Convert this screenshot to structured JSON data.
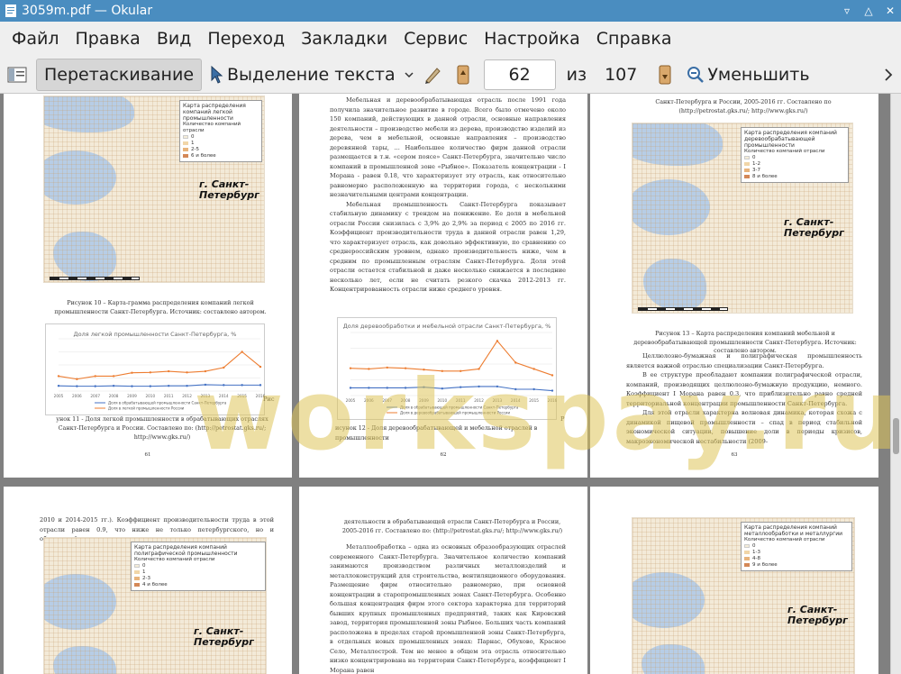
{
  "window": {
    "title": "3059m.pdf — Okular"
  },
  "menu": [
    "Файл",
    "Правка",
    "Вид",
    "Переход",
    "Закладки",
    "Сервис",
    "Настройка",
    "Справка"
  ],
  "toolbar": {
    "drag_label": "Перетаскивание",
    "select_label": "Выделение текста",
    "current_page": "62",
    "of_label": "из",
    "total_pages": "107",
    "zoom_out_label": "Уменьшить"
  },
  "watermark": "workspay.ru",
  "pages": {
    "p61": {
      "map_title": "Карта распределения компаний легкой промышленности",
      "legend_title": "Количество компаний отрасли",
      "legend_items": [
        "0",
        "1",
        "2-5",
        "6 и более"
      ],
      "city": "г. Санкт-Петербург",
      "caption": "Рисунок 10 – Карта-граммa распределения компаний легкой промышленности Санкт-Петербурга. Источник: составлено автором.",
      "chart_title": "Доля легкой промышленности Санкт-Петербурга, %",
      "legend_a": "Доля в обрабатывающей промышленности Санкт-Петербурга",
      "legend_b": "Доля в легкой промышленности России",
      "tail": "унок 11 - Доля легкой промышленности в обрабатывающих отраслях Санкт-Петербурга и России. Составлено по: (http://petrostat.gks.ru/; http://www.gks.ru/)",
      "ric": "Рис",
      "num": "61"
    },
    "p62": {
      "para1": "Мебельная и деревообрабатывающая отрасль после 1991 года получила значительное развитие в городе. Всего было отмечено около 150 компаний, действующих в данной отрасли, основные направления деятельности – производство мебели из дерева, производство изделий из дерева, чем в мебельной, основные направления – производство деревянной тары, ... Наибольшее количество фирм данной отрасли размещается в т.н. «сером поясе» Санкт-Петербурга, значительно число компаний в промышленной зоне «Рыбное». Показатель концентрации - I Моранa - равен 0.18, что характеризует эту отрасль, как относительно равномерно расположенную на территории города, с несколькими незначительными центрами концентрации.",
      "para2": "Мебельная промышленность Санкт-Петербурга показывает стабильную динамику с трендом на понижение. Ее доля в мебельной отрасли России снизилась с 3,9% до 2,9% за период с 2005 по 2016 гг. Коэффициент производительности труда в данной отрасли равен 1,29, что характеризует отрасль, как довольно эффективную, по сравнению со среднероссийским уровнем, однако производительность ниже, чем в средним по промышленным отраслям Санкт-Петербурга. Доля этой отрасли остается стабильной и даже несколько снижается в последние несколько лет, если не считать резкого скачка 2012-2013 гг. Концентрированность отрасли ниже среднего уровня.",
      "chart_title": "Доля деревообработки и мебельной отрасли Санкт-Петербурга, %",
      "legend_a": "Доля в обрабатывающей промышленности Санкт-Петербурга",
      "legend_b": "Доля в деревообрабатывающей промышленности России",
      "tail": "исунок 12 - Доля деревообрабатывающей и мебельной отраслей в промышленности",
      "ric": "Р",
      "num": "62"
    },
    "p63": {
      "head": "Санкт-Петербурга и России, 2005-2016 гг. Составлено по (http://petrostat.gks.ru/; http://www.gks.ru/)",
      "map_title": "Карта распределения компаний деревообрабатывающей промышленности",
      "legend_title": "Количество компаний отрасли",
      "legend_items": [
        "0",
        "1-2",
        "3-7",
        "8 и более"
      ],
      "city": "г. Санкт-Петербург",
      "caption": "Рисунок 13 – Карта распределения компаний мебельной и деревообрабатывающей промышленности Санкт-Петербурга. Источник: составлено автором.",
      "para1": "Целлюлозно-бумажная и полиграфическая промышленность является важной отраслью специализации Санкт-Петербурга.",
      "para2": "В ее структуре преобладают компании полиграфической отрасли, компаний, производящих целлюлозно-бумажную продукцию, немного. Коэффициент I Морана равен 0.3, что приблизительно равно средней территориальной концентрации промышленности Санкт-Петербурга.",
      "para3": "Для этой отрасли характерна волновая динамика, которая схожа с динамикой пищевой промышленности – спад в период стабильной экономической ситуации, повышение доли в периоды кризисов, макроэкономической нестабильности (2009-",
      "num": "63"
    },
    "p64": {
      "head": "2010 и 2014-2015 гг.). Коэффициент производительности труда в этой отрасли равен 0.9, что ниже не только петербургского, но и общероссийского уровня.",
      "map_title": "Карта распределения компаний полиграфической промышленности",
      "legend_title": "Количество компаний отрасли",
      "legend_items": [
        "0",
        "1",
        "2-3",
        "4 и более"
      ],
      "city": "г. Санкт-Петербург"
    },
    "p65": {
      "head": "деятельности в обрабатывающей отрасли Санкт-Петербурга и России, 2005-2016 гг. Составлено по: (http://petrostat.gks.ru/; http://www.gks.ru/)",
      "para": "Металлообработка – одна из основных образообразующих отраслей современного Санкт-Петербурга. Значительное количество компаний занимаются производством различных металлоизделий и металлоконструкций для строительства, вентиляционного оборудования. Размещение фирм относительно равномерно, при основной концентрации в старопромышленных зонах Санкт-Петербурга. Особенно большая концентрация фирм этого сектора характерна для территорий бывших крупных промышленных предприятий, таких как Кировский завод, территория промышленной зоны Рыбное. Больших часть компаний расположена в пределах старой промышленной зоны Санкт-Петербурга, в отдельных новых промышленных зонах: Парнас, Обухово, Красное Село, Металлострой. Тем не менее в общем эта отрасль относительно низко концентрирована на территории Санкт-Петербурга, коэффициент I Морана равен"
    },
    "p66": {
      "map_title": "Карта распределения компаний металлообработки и металлургии",
      "legend_title": "Количество компаний отрасли",
      "legend_items": [
        "0",
        "1-3",
        "4-8",
        "9 и более"
      ],
      "city": "г. Санкт-Петербург"
    }
  },
  "chart_data": [
    {
      "type": "line",
      "title": "Доля легкой промышленности Санкт-Петербурга, %",
      "x": [
        "2005",
        "2006",
        "2007",
        "2008",
        "2009",
        "2010",
        "2011",
        "2012",
        "2013",
        "2014",
        "2015",
        "2016"
      ],
      "ylim": [
        0,
        14
      ],
      "series": [
        {
          "name": "Доля в обрабатывающей промышленности Санкт-Петербурга",
          "values": [
            1.4,
            1.3,
            1.3,
            1.4,
            1.3,
            1.3,
            1.4,
            1.4,
            1.7,
            1.6,
            1.6,
            1.6
          ]
        },
        {
          "name": "Доля в легкой промышленности России",
          "values": [
            4.0,
            3.2,
            4.0,
            4.0,
            4.9,
            5.0,
            5.3,
            5.0,
            5.3,
            6.3,
            10.5,
            6.5
          ]
        }
      ]
    },
    {
      "type": "line",
      "title": "Доля деревообработки и мебельной отрасли Санкт-Петербурга, %",
      "x": [
        "2005",
        "2006",
        "2007",
        "2008",
        "2009",
        "2010",
        "2011",
        "2012",
        "2013",
        "2014",
        "2015",
        "2016"
      ],
      "ylim": [
        0,
        9
      ],
      "series": [
        {
          "name": "Доля в обрабатывающей промышленности Санкт-Петербурга",
          "values": [
            1.1,
            1.1,
            1.1,
            1.1,
            1.2,
            1.0,
            1.2,
            1.3,
            1.3,
            0.9,
            0.9,
            0.7
          ]
        },
        {
          "name": "Доля в деревообрабатывающей промышленности России",
          "values": [
            3.9,
            3.8,
            4.0,
            3.9,
            3.7,
            3.5,
            3.5,
            3.8,
            7.8,
            4.7,
            3.8,
            2.9
          ]
        }
      ]
    }
  ]
}
